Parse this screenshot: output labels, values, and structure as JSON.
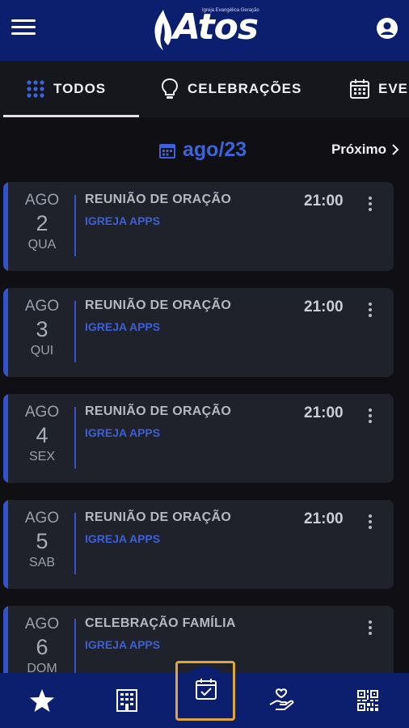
{
  "header": {
    "logo_text": "Atos",
    "logo_subtitle": "Igreja Evangélica Geração",
    "menu_icon": "hamburger-menu-icon",
    "account_icon": "account-circle-icon"
  },
  "tabs": [
    {
      "label": "TODOS",
      "icon": "grid-icon",
      "active": true
    },
    {
      "label": "CELEBRAÇÕES",
      "icon": "lightbulb-icon",
      "active": false
    },
    {
      "label": "EVE",
      "icon": "calendar-icon",
      "active": false
    }
  ],
  "month_nav": {
    "month": "ago/23",
    "next_label": "Próximo"
  },
  "events": [
    {
      "month": "AGO",
      "day": "2",
      "weekday": "QUA",
      "title": "REUNIÃO DE ORAÇÃO",
      "org": "IGREJA APPS",
      "time": "21:00"
    },
    {
      "month": "AGO",
      "day": "3",
      "weekday": "QUI",
      "title": "REUNIÃO DE ORAÇÃO",
      "org": "IGREJA APPS",
      "time": "21:00"
    },
    {
      "month": "AGO",
      "day": "4",
      "weekday": "SEX",
      "title": "REUNIÃO DE ORAÇÃO",
      "org": "IGREJA APPS",
      "time": "21:00"
    },
    {
      "month": "AGO",
      "day": "5",
      "weekday": "SAB",
      "title": "REUNIÃO DE ORAÇÃO",
      "org": "IGREJA APPS",
      "time": "21:00"
    },
    {
      "month": "AGO",
      "day": "6",
      "weekday": "DOM",
      "title": "CELEBRAÇÃO FAMÍLIA",
      "org": "IGREJA APPS",
      "time": ""
    }
  ],
  "bottom_nav": [
    {
      "icon": "star-icon"
    },
    {
      "icon": "building-icon"
    },
    {
      "icon": "calendar-check-icon",
      "active": true
    },
    {
      "icon": "giving-hand-icon"
    },
    {
      "icon": "qr-code-icon"
    }
  ],
  "colors": {
    "brand_blue": "#0b1f6e",
    "accent_blue": "#3d63d8",
    "card_bg": "#1f222b",
    "active_outline": "#e0a53a"
  }
}
